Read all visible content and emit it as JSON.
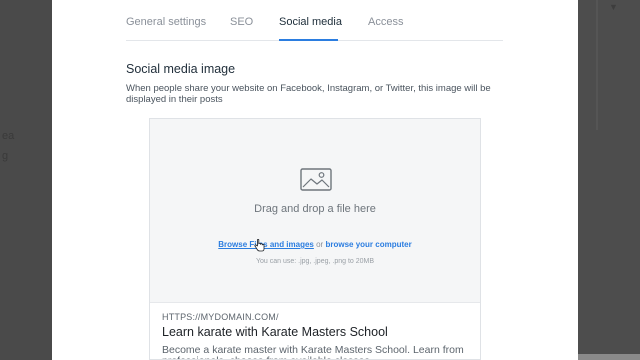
{
  "tabs": [
    {
      "label": "General settings",
      "active": false
    },
    {
      "label": "SEO",
      "active": false
    },
    {
      "label": "Social media",
      "active": true
    },
    {
      "label": "Access",
      "active": false
    }
  ],
  "section": {
    "title": "Social media image",
    "description": "When people share your website on Facebook, Instagram, or Twitter, this image will be displayed in their posts"
  },
  "upload": {
    "icon": "image-icon",
    "drag_text": "Drag and drop a file here",
    "browse_files_label": "Browse Files and images",
    "or_text": "or",
    "browse_computer_label": "browse your computer",
    "file_hint": "You can use: .jpg, .jpeg, .png to 20MB"
  },
  "preview": {
    "url": "HTTPS://MYDOMAIN.COM/",
    "title": "Learn karate with Karate Masters School",
    "description": "Become a karate master with Karate Masters School. Learn from professionals, choose from available classes"
  },
  "colors": {
    "accent": "#2b7de0",
    "backdrop": "#4d4d4d"
  }
}
